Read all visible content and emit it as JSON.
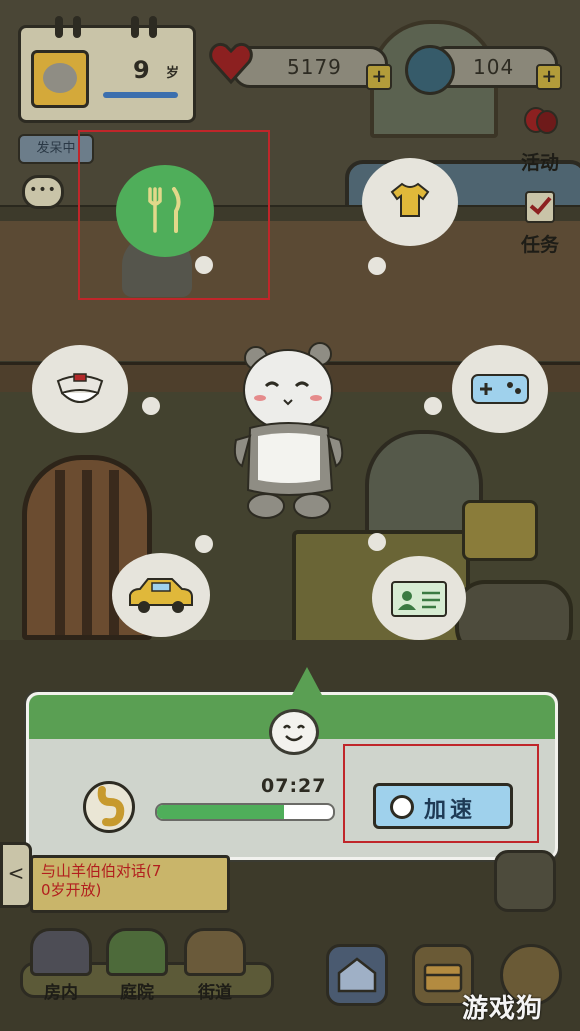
{
  "header": {
    "age_value": "9",
    "age_unit": "岁",
    "status_tag": "发呆中",
    "chat_label": "•••"
  },
  "resources": {
    "hearts": "5179",
    "coins": "104",
    "plus_label": "+"
  },
  "side_menu": {
    "activity_label": "活动",
    "task_label": "任务"
  },
  "bubbles": [
    {
      "name": "food",
      "icon": "fork-knife-icon",
      "highlighted": true
    },
    {
      "name": "clothes",
      "icon": "tshirt-icon"
    },
    {
      "name": "study",
      "icon": "hat-icon"
    },
    {
      "name": "game",
      "icon": "gamepad-icon"
    },
    {
      "name": "travel",
      "icon": "car-icon"
    },
    {
      "name": "id-card",
      "icon": "id-card-icon"
    }
  ],
  "status_panel": {
    "timer": "07:27",
    "progress": 0.72,
    "speed_up_label": "加速"
  },
  "quest": {
    "text_line1": "与山羊伯伯对话(7",
    "text_line2": "0岁开放)",
    "arrow": "<"
  },
  "nav": {
    "room_label": "房内",
    "yard_label": "庭院",
    "street_label": "街道"
  },
  "watermark": "游戏狗",
  "colors": {
    "green": "#4fae5a",
    "highlight_red": "#c0262a",
    "button_blue": "#9fd1ec"
  }
}
